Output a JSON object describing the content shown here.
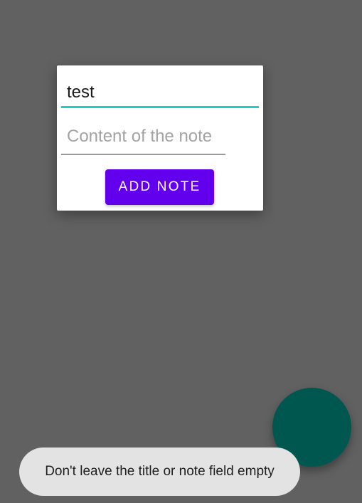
{
  "dialog": {
    "title_value": "test",
    "content_placeholder": "Content of the note",
    "add_button_label": "ADD NOTE"
  },
  "toast": {
    "message": "Don't leave the title or note field empty"
  },
  "fab": {
    "icon": "add-note-icon"
  },
  "colors": {
    "scrim": "#616161",
    "accent": "#19d1c4",
    "primary": "#6200ee",
    "fab": "#00574f",
    "toast_bg": "#e3e3e3"
  }
}
